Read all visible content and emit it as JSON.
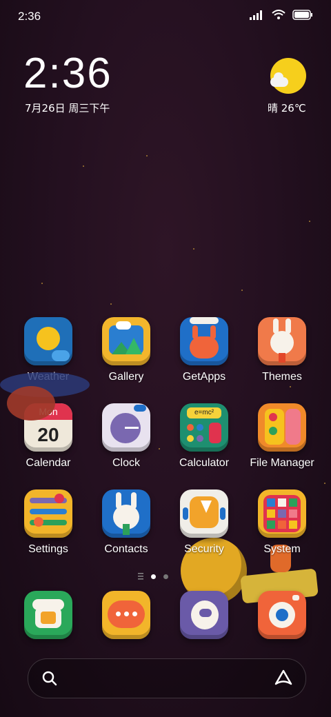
{
  "status_bar": {
    "time": "2:36"
  },
  "clock": {
    "time": "2:36",
    "date": "7月26日 周三下午"
  },
  "weather": {
    "text": "晴 26℃",
    "icon": "sun-cloud-icon"
  },
  "apps": [
    {
      "label": "Weather",
      "icon": "weather-icon",
      "color": "#1f6fb8"
    },
    {
      "label": "Gallery",
      "icon": "gallery-icon",
      "color": "#f2b62c"
    },
    {
      "label": "GetApps",
      "icon": "getapps-icon",
      "color": "#1f6fc8"
    },
    {
      "label": "Themes",
      "icon": "themes-icon",
      "color": "#f07a4a"
    },
    {
      "label": "Calendar",
      "icon": "calendar-icon",
      "color": "#efe8da"
    },
    {
      "label": "Clock",
      "icon": "clock-icon",
      "color": "#e8e2ef"
    },
    {
      "label": "Calculator",
      "icon": "calculator-icon",
      "color": "#1e8f70"
    },
    {
      "label": "File Manager",
      "icon": "file-manager-icon",
      "color": "#f08a2a"
    },
    {
      "label": "Settings",
      "icon": "settings-icon",
      "color": "#f2b52a"
    },
    {
      "label": "Contacts",
      "icon": "contacts-icon",
      "color": "#1f6fc8"
    },
    {
      "label": "Security",
      "icon": "security-icon",
      "color": "#f0eee8"
    },
    {
      "label": "System",
      "icon": "system-icon",
      "color": "#f2b52a"
    }
  ],
  "calendar_icon": {
    "month": "Mon",
    "day": "20"
  },
  "calculator_icon": {
    "formula": "e=mc²"
  },
  "dock": [
    {
      "icon": "phone-icon",
      "color": "#2aa85a"
    },
    {
      "icon": "messages-icon",
      "color": "#f2b52a"
    },
    {
      "icon": "browser-icon",
      "color": "#6a5aa8"
    },
    {
      "icon": "camera-icon",
      "color": "#f0643a"
    }
  ],
  "search": {
    "icon": "search-icon",
    "assistant_icon": "assistant-icon"
  }
}
